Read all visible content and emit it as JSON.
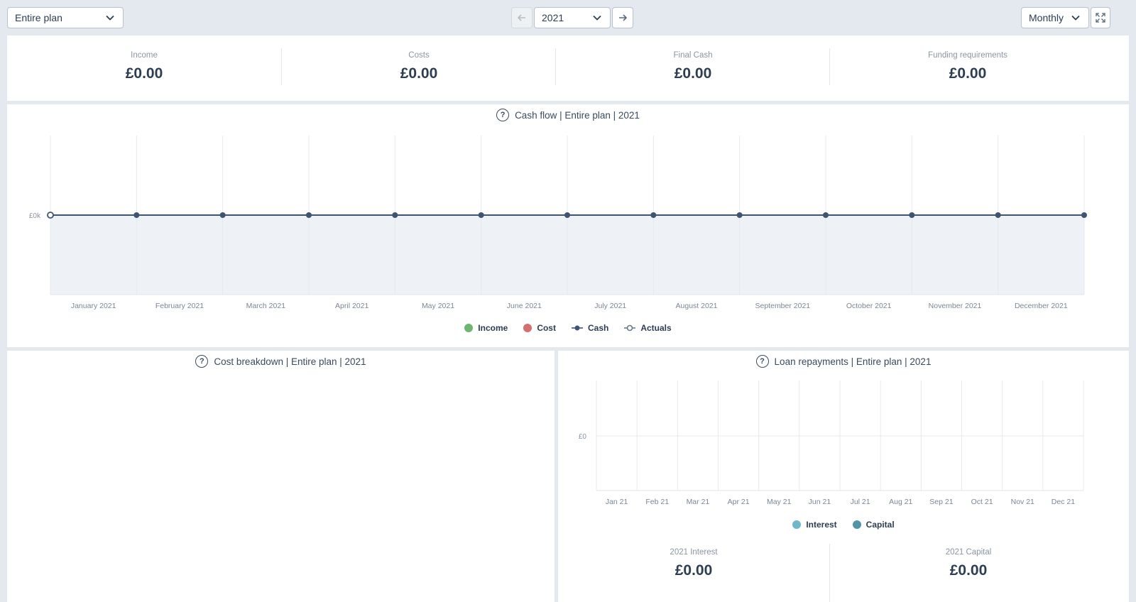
{
  "toolbar": {
    "scope_select": "Entire plan",
    "year_select": "2021",
    "period_select": "Monthly",
    "prev_icon": "arrow-left-icon",
    "next_icon": "arrow-right-icon",
    "expand_icon": "expand-icon"
  },
  "kpis": [
    {
      "label": "Income",
      "value": "£0.00"
    },
    {
      "label": "Costs",
      "value": "£0.00"
    },
    {
      "label": "Final Cash",
      "value": "£0.00"
    },
    {
      "label": "Funding requirements",
      "value": "£0.00"
    }
  ],
  "cashflow": {
    "title": "Cash flow | Entire plan | 2021",
    "legend": [
      {
        "label": "Income",
        "color": "#6cb66f",
        "marker": "dot"
      },
      {
        "label": "Cost",
        "color": "#d46f6f",
        "marker": "dot"
      },
      {
        "label": "Cash",
        "color": "#3f5373",
        "marker": "line-dot"
      },
      {
        "label": "Actuals",
        "color": "#6b7a8d",
        "marker": "line-ring"
      }
    ]
  },
  "cost_breakdown": {
    "title": "Cost breakdown | Entire plan | 2021"
  },
  "loans": {
    "title": "Loan repayments | Entire plan | 2021",
    "legend": [
      {
        "label": "Interest",
        "color": "#6fb7c9"
      },
      {
        "label": "Capital",
        "color": "#4f95a6"
      }
    ],
    "totals": [
      {
        "label": "2021 Interest",
        "value": "£0.00"
      },
      {
        "label": "2021 Capital",
        "value": "£0.00"
      }
    ]
  },
  "chart_data": [
    {
      "type": "line",
      "categories": [
        "January 2021",
        "February 2021",
        "March 2021",
        "April 2021",
        "May 2021",
        "June 2021",
        "July 2021",
        "August 2021",
        "September 2021",
        "October 2021",
        "November 2021",
        "December 2021"
      ],
      "yticks": [
        "£0k"
      ],
      "grid": true,
      "series": [
        {
          "name": "Cash",
          "values": [
            0,
            0,
            0,
            0,
            0,
            0,
            0,
            0,
            0,
            0,
            0,
            0,
            0
          ]
        }
      ]
    },
    {
      "type": "bar",
      "categories": [
        "Jan 21",
        "Feb 21",
        "Mar 21",
        "Apr 21",
        "May 21",
        "Jun 21",
        "Jul 21",
        "Aug 21",
        "Sep 21",
        "Oct 21",
        "Nov 21",
        "Dec 21"
      ],
      "yticks": [
        "£0"
      ],
      "grid": true,
      "series": [
        {
          "name": "Interest",
          "values": [
            0,
            0,
            0,
            0,
            0,
            0,
            0,
            0,
            0,
            0,
            0,
            0
          ]
        },
        {
          "name": "Capital",
          "values": [
            0,
            0,
            0,
            0,
            0,
            0,
            0,
            0,
            0,
            0,
            0,
            0
          ]
        }
      ]
    }
  ]
}
